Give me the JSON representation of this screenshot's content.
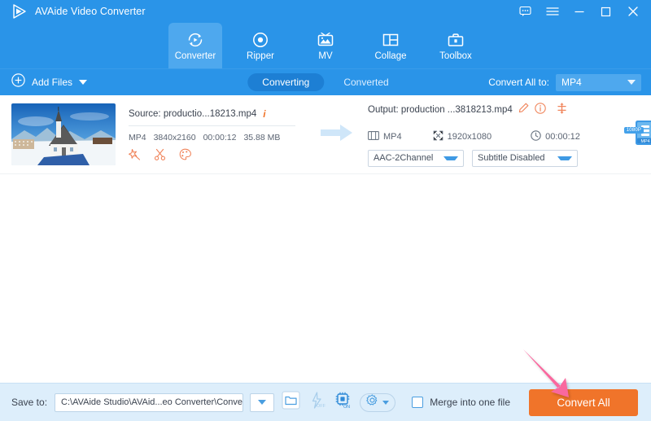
{
  "app": {
    "title": "AVAide Video Converter",
    "accent_blue": "#2a94e8",
    "accent_orange": "#f0742a",
    "annotation_color": "#f9679e"
  },
  "titlebar": {
    "feedback_icon": "feedback-icon",
    "menu_icon": "hamburger-menu-icon",
    "minimize_icon": "minimize-icon",
    "maximize_icon": "maximize-icon",
    "close_icon": "close-icon"
  },
  "nav": {
    "tabs": [
      {
        "label": "Converter",
        "icon": "converter-icon",
        "active": true
      },
      {
        "label": "Ripper",
        "icon": "ripper-icon",
        "active": false
      },
      {
        "label": "MV",
        "icon": "mv-icon",
        "active": false
      },
      {
        "label": "Collage",
        "icon": "collage-icon",
        "active": false
      },
      {
        "label": "Toolbox",
        "icon": "toolbox-icon",
        "active": false
      }
    ]
  },
  "toolbar": {
    "add_files_label": "Add Files",
    "add_files_icon": "plus-circle-icon",
    "segments": [
      {
        "label": "Converting",
        "active": true
      },
      {
        "label": "Converted",
        "active": false
      }
    ],
    "convert_all_to_label": "Convert All to:",
    "convert_all_to_value": "MP4"
  },
  "file": {
    "thumbnail_alt": "snowy-mountain-chapel-thumbnail",
    "source_label": "Source: productio...18213.mp4",
    "source_info_icon": "info-italic-icon",
    "meta": {
      "format": "MP4",
      "resolution": "3840x2160",
      "duration": "00:00:12",
      "size": "35.88 MB"
    },
    "edit_icons": [
      {
        "name": "magic-wand-icon"
      },
      {
        "name": "scissors-trim-icon"
      },
      {
        "name": "palette-effects-icon"
      }
    ],
    "transfer_arrow_icon": "right-arrow-icon",
    "output_label": "Output: production ...3818213.mp4",
    "output_edit_icon": "pencil-edit-icon",
    "output_info_icon": "info-circle-icon",
    "output_move_icon": "move-handle-icon",
    "output_meta": {
      "format": "MP4",
      "format_icon": "video-file-icon",
      "resolution": "1920x1080",
      "resolution_icon": "resize-icon",
      "duration": "00:00:12",
      "duration_icon": "clock-icon"
    },
    "audio_track": "AAC-2Channel",
    "subtitle_track": "Subtitle Disabled",
    "format_badge_quality": "1080P",
    "format_badge_label": "MP4",
    "format_badge_icon": "mp4-format-icon"
  },
  "bottom": {
    "save_to_label": "Save to:",
    "save_to_path": "C:\\AVAide Studio\\AVAid...eo Converter\\Converted",
    "path_dropdown_icon": "chevron-down-icon",
    "folder_icon": "open-folder-icon",
    "gpu_icon": "lightning-off-icon",
    "gpu_state": "OFF",
    "hwaccel_icon": "chip-on-icon",
    "hwaccel_state": "ON",
    "settings_icon": "gear-icon",
    "merge_label": "Merge into one file",
    "merge_checked": false,
    "convert_button_label": "Convert All"
  },
  "annotation": {
    "arrow_icon": "pointer-arrow-annotation",
    "points_to": "Convert All"
  }
}
